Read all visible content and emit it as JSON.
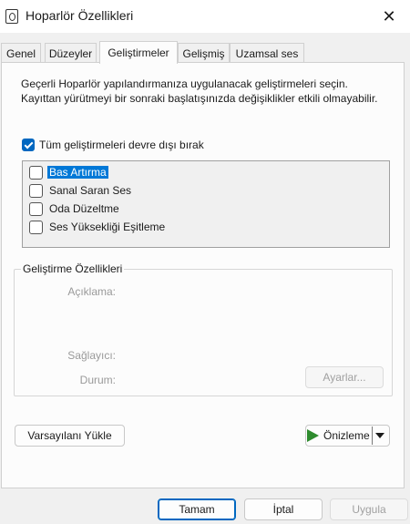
{
  "window": {
    "title": "Hoparlör Özellikleri"
  },
  "tabs": [
    {
      "label": "Genel"
    },
    {
      "label": "Düzeyler"
    },
    {
      "label": "Geliştirmeler"
    },
    {
      "label": "Gelişmiş"
    },
    {
      "label": "Uzamsal ses"
    }
  ],
  "description": "Geçerli Hoparlör yapılandırmanıza uygulanacak geliştirmeleri seçin. Kayıttan yürütmeyi bir sonraki başlatışınızda değişiklikler etkili olmayabilir.",
  "disable_all": {
    "label": "Tüm geliştirmeleri devre dışı bırak",
    "checked": true
  },
  "enhancements": [
    {
      "label": "Bas Artırma",
      "checked": false,
      "selected": true
    },
    {
      "label": "Sanal Saran Ses",
      "checked": false,
      "selected": false
    },
    {
      "label": "Oda Düzeltme",
      "checked": false,
      "selected": false
    },
    {
      "label": "Ses Yüksekliği Eşitleme",
      "checked": false,
      "selected": false
    }
  ],
  "properties": {
    "title": "Geliştirme Özellikleri",
    "description_label": "Açıklama:",
    "provider_label": "Sağlayıcı:",
    "status_label": "Durum:",
    "settings_button": "Ayarlar..."
  },
  "restore_defaults_button": "Varsayılanı Yükle",
  "preview_button": "Önizleme",
  "footer": {
    "ok": "Tamam",
    "cancel": "İptal",
    "apply": "Uygula"
  },
  "colors": {
    "accent": "#0067c0",
    "selection": "#0078d7",
    "play_icon": "#2e8b2e"
  }
}
